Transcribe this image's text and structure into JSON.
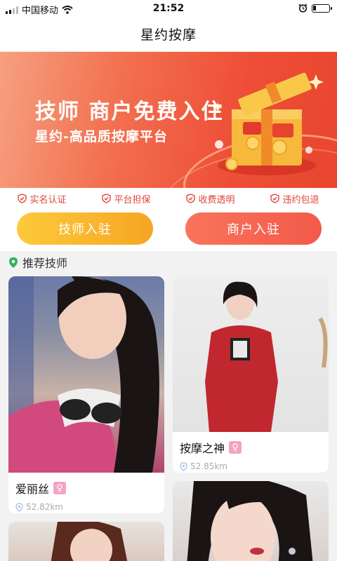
{
  "status_bar": {
    "carrier": "中国移动",
    "time": "21:52",
    "battery_level": 0.2
  },
  "nav": {
    "title": "星约按摩"
  },
  "banner": {
    "title": "技师  商户免费入住",
    "subtitle": "星约-高品质按摩平台"
  },
  "features": [
    "实名认证",
    "平台担保",
    "收费透明",
    "违约包退"
  ],
  "join": {
    "tech_label": "技师入驻",
    "shop_label": "商户入驻"
  },
  "section": {
    "title": "推荐技师"
  },
  "cards": [
    {
      "name": "爱丽丝",
      "gender": "♀",
      "distance": "52.82km"
    },
    {
      "name": "按摩之神",
      "gender": "♀",
      "distance": "52.85km"
    }
  ],
  "colors": {
    "accent_red": "#e0443a",
    "gold": "#f6a623",
    "coral": "#f25a4a",
    "gender_pink": "#f4a3c4"
  }
}
